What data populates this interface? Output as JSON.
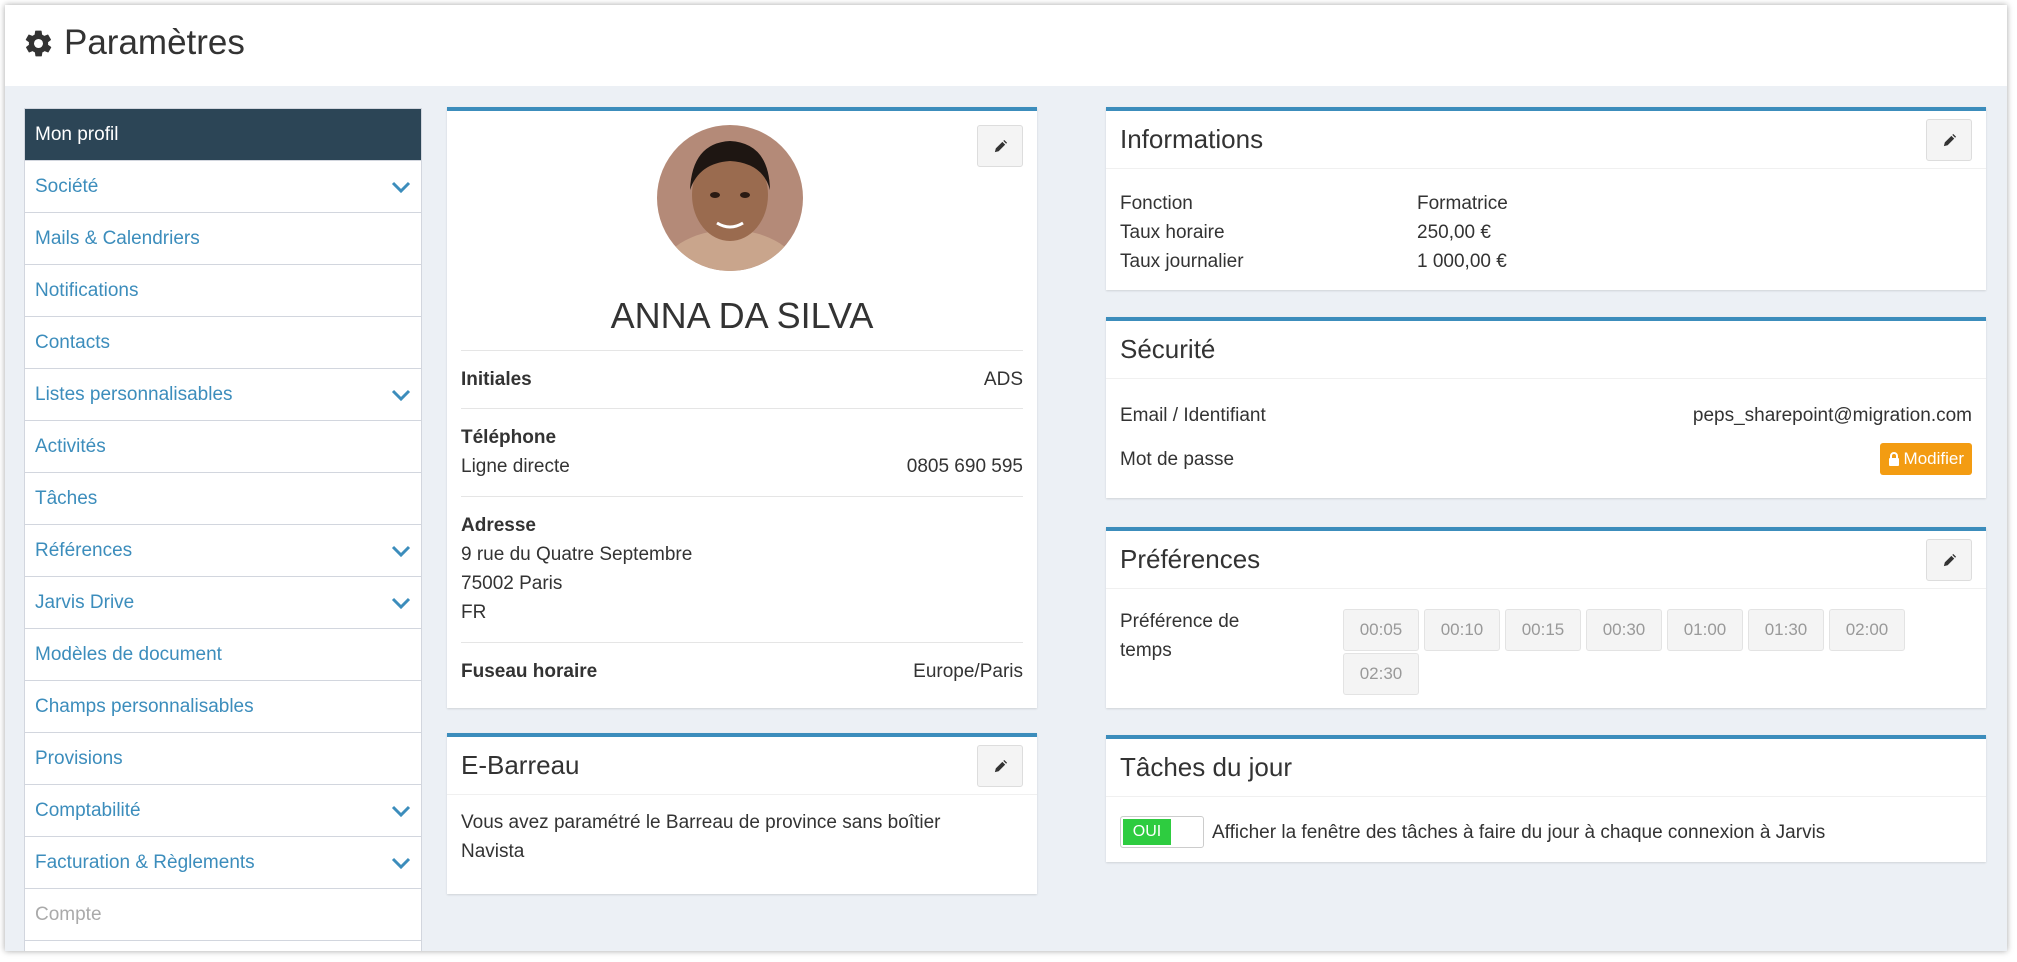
{
  "header": {
    "title": "Paramètres",
    "icon": "gear-icon"
  },
  "sidebar": {
    "items": [
      {
        "label": "Mon profil"
      },
      {
        "label": "Société"
      },
      {
        "label": "Mails & Calendriers"
      },
      {
        "label": "Notifications"
      },
      {
        "label": "Contacts"
      },
      {
        "label": "Listes personnalisables"
      },
      {
        "label": "Activités"
      },
      {
        "label": "Tâches"
      },
      {
        "label": "Références"
      },
      {
        "label": "Jarvis Drive"
      },
      {
        "label": "Modèles de document"
      },
      {
        "label": "Champs personnalisables"
      },
      {
        "label": "Provisions"
      },
      {
        "label": "Comptabilité"
      },
      {
        "label": "Facturation & Règlements"
      },
      {
        "label": "Compte"
      }
    ]
  },
  "profile": {
    "name": "ANNA DA SILVA",
    "initials_label": "Initiales",
    "initials": "ADS",
    "phone_label": "Téléphone",
    "phone_type": "Ligne directe",
    "phone": "0805 690 595",
    "address_label": "Adresse",
    "address_line1": "9 rue du Quatre Septembre",
    "address_line2": "75002 Paris",
    "address_line3": "FR",
    "timezone_label": "Fuseau horaire",
    "timezone": "Europe/Paris"
  },
  "ebarreau": {
    "title": "E-Barreau",
    "text": "Vous avez paramétré le Barreau de province sans boîtier Navista"
  },
  "informations": {
    "title": "Informations",
    "rows": [
      {
        "label": "Fonction",
        "value": "Formatrice"
      },
      {
        "label": "Taux horaire",
        "value": "250,00 €"
      },
      {
        "label": "Taux journalier",
        "value": "1 000,00 €"
      }
    ]
  },
  "securite": {
    "title": "Sécurité",
    "email_label": "Email / Identifiant",
    "email": "peps_sharepoint@migration.com",
    "password_label": "Mot de passe",
    "modify_label": "Modifier"
  },
  "preferences": {
    "title": "Préférences",
    "time_label": "Préférence de temps",
    "options": [
      "00:05",
      "00:10",
      "00:15",
      "00:30",
      "01:00",
      "01:30",
      "02:00",
      "02:30"
    ]
  },
  "taches": {
    "title": "Tâches du jour",
    "toggle_label": "OUI",
    "text": "Afficher la fenêtre des tâches à faire du jour à chaque connexion à Jarvis"
  },
  "colors": {
    "accent": "#3c8dbc",
    "sidebar_active": "#2c4556",
    "warning": "#f39c12",
    "success": "#2ecc40",
    "background": "#ecf0f5"
  }
}
